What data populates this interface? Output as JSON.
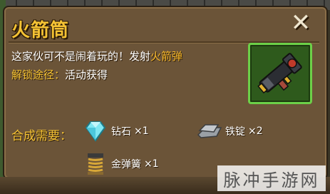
{
  "item": {
    "name": "火箭筒",
    "desc_prefix": "这家伙可不是闹着玩的！发射",
    "desc_highlight": "火箭弹",
    "unlock_label": "解锁途径：",
    "unlock_value": "活动获得",
    "icon": "rocket-launcher-icon"
  },
  "recipe": {
    "label": "合成需要：",
    "materials": [
      {
        "name": "钻石",
        "count": "×1",
        "icon": "diamond-icon"
      },
      {
        "name": "铁锭",
        "count": "×2",
        "icon": "iron-ingot-icon"
      },
      {
        "name": "金弹簧",
        "count": "×1",
        "icon": "gold-spring-icon"
      }
    ]
  },
  "close_icon": "close-icon",
  "watermark": "脉冲手游网",
  "colors": {
    "title": "#f4c234",
    "highlight": "#f4b62a",
    "panel": "#6b5438",
    "item_frame_border": "#6cd048"
  }
}
